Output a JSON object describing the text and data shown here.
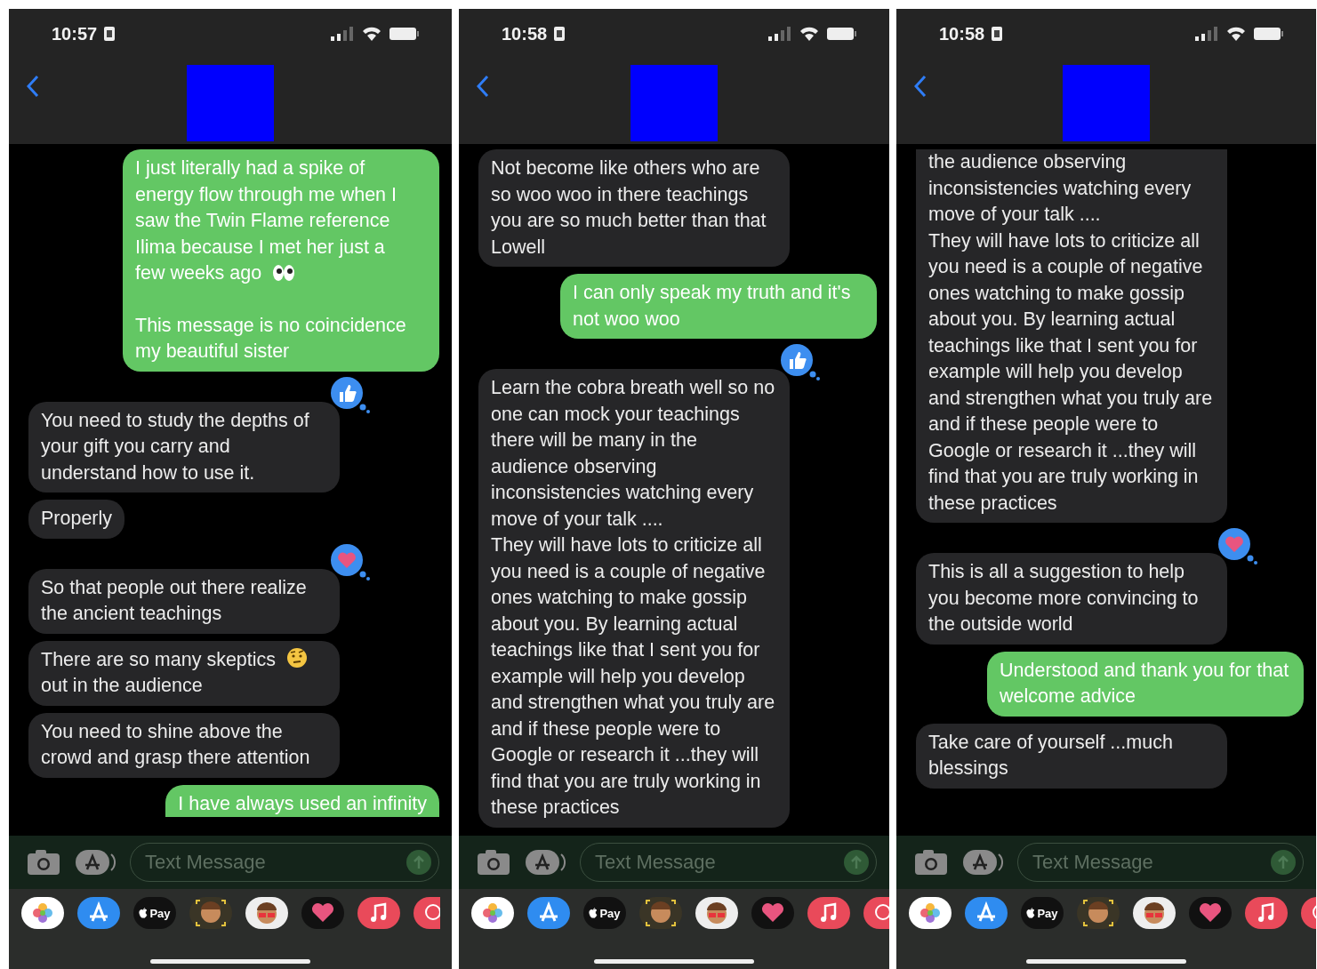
{
  "phones": [
    {
      "time": "10:57",
      "messages": [
        {
          "kind": "sent",
          "paragraphs": [
            [
              {
                "kind": "text",
                "text": "I just literally had a spike of energy flow through me when I saw the Twin Flame reference Ilima because I met her just a"
              },
              {
                "kind": "text",
                "text": "few weeks ago"
              },
              {
                "kind": "eyes"
              }
            ],
            [
              {
                "kind": "text",
                "text": "This message is no coincidence my beautiful sister"
              }
            ]
          ]
        },
        {
          "kind": "received",
          "reaction": {
            "kind": "like"
          },
          "paragraphs": [
            [
              {
                "kind": "text",
                "text": "You need to study the depths of your gift you carry and understand how to use it."
              }
            ]
          ]
        },
        {
          "kind": "received",
          "paragraphs": [
            [
              {
                "kind": "text",
                "text": "Properly"
              }
            ]
          ]
        },
        {
          "kind": "received",
          "reaction": {
            "kind": "heart"
          },
          "paragraphs": [
            [
              {
                "kind": "text",
                "text": "So that people out there realize the ancient teachings"
              }
            ]
          ]
        },
        {
          "kind": "received",
          "paragraphs": [
            [
              {
                "kind": "text",
                "text": "There are so many skeptics"
              },
              {
                "kind": "face"
              },
              {
                "kind": "text",
                "text": "out in the audience"
              }
            ]
          ]
        },
        {
          "kind": "received",
          "paragraphs": [
            [
              {
                "kind": "text",
                "text": "You need to shine above the crowd and grasp there attention"
              }
            ]
          ]
        },
        {
          "kind": "sent",
          "cut_bottom": true,
          "paragraphs": [
            [
              {
                "kind": "text",
                "text": "I have always used an infinity"
              }
            ]
          ]
        }
      ],
      "placeholder": "Text Message",
      "apps": [
        {
          "kind": "photos"
        },
        {
          "kind": "appstore"
        },
        {
          "kind": "pay",
          "label": "Pay"
        },
        {
          "kind": "memoji"
        },
        {
          "kind": "stickers"
        },
        {
          "kind": "touch"
        },
        {
          "kind": "music"
        },
        {
          "kind": "web"
        }
      ]
    },
    {
      "time": "10:58",
      "messages": [
        {
          "kind": "received",
          "paragraphs": [
            [
              {
                "kind": "text",
                "text": "Not become like others who are so woo woo in there teachings you are so much better than that Lowell"
              }
            ]
          ]
        },
        {
          "kind": "sent",
          "paragraphs": [
            [
              {
                "kind": "text",
                "text": "I can only speak my truth and it's not woo woo"
              }
            ]
          ]
        },
        {
          "kind": "received",
          "reaction": {
            "kind": "like"
          },
          "paragraphs": [
            [
              {
                "kind": "text",
                "text": "Learn the cobra breath well so no one can mock your teachings there will be many in the audience observing inconsistencies watching every move of your talk ....\nThey will have lots to criticize all you need is a couple of negative ones watching to make gossip about you. By learning actual teachings like that I sent you for example will help you develop and strengthen what you truly are and if these people were to Google or research it ...they will find that you are truly working in these practices"
              }
            ]
          ]
        }
      ],
      "placeholder": "Text Message",
      "apps": [
        {
          "kind": "photos"
        },
        {
          "kind": "appstore"
        },
        {
          "kind": "pay",
          "label": "Pay"
        },
        {
          "kind": "memoji"
        },
        {
          "kind": "stickers"
        },
        {
          "kind": "touch"
        },
        {
          "kind": "music"
        },
        {
          "kind": "web"
        }
      ]
    },
    {
      "time": "10:58",
      "messages": [
        {
          "kind": "received",
          "cut_top": true,
          "paragraphs": [
            [
              {
                "kind": "text",
                "text": "the audience observing inconsistencies watching every move of your talk ....\nThey will have lots to criticize all you need is a couple of negative ones watching to make gossip about you. By learning actual teachings like that I sent you for example will help you develop and strengthen what you truly are and if these people were to Google or research it ...they will find that you are truly working in these practices"
              }
            ]
          ]
        },
        {
          "kind": "received",
          "reaction": {
            "kind": "heart"
          },
          "paragraphs": [
            [
              {
                "kind": "text",
                "text": "This is all a suggestion to help you become more convincing to the outside world"
              }
            ]
          ]
        },
        {
          "kind": "sent",
          "paragraphs": [
            [
              {
                "kind": "text",
                "text": "Understood and thank you for that welcome advice"
              }
            ]
          ]
        },
        {
          "kind": "received",
          "paragraphs": [
            [
              {
                "kind": "text",
                "text": "Take care of yourself ...much blessings"
              }
            ]
          ]
        }
      ],
      "placeholder": "Text Message",
      "apps": [
        {
          "kind": "photos"
        },
        {
          "kind": "appstore"
        },
        {
          "kind": "pay",
          "label": "Pay"
        },
        {
          "kind": "memoji"
        },
        {
          "kind": "stickers"
        },
        {
          "kind": "touch"
        },
        {
          "kind": "music"
        },
        {
          "kind": "web"
        }
      ]
    }
  ]
}
